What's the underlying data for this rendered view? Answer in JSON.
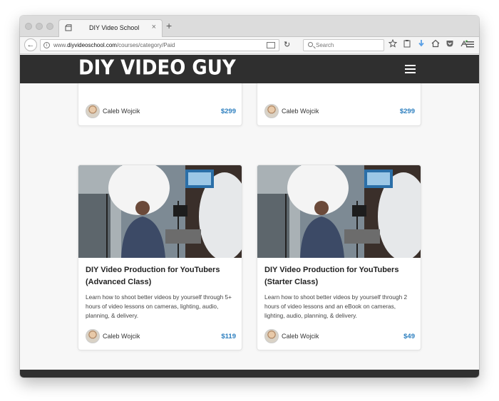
{
  "browser": {
    "tab_title": "DIY Video School",
    "tab_close": "×",
    "new_tab": "+",
    "url_prefix": "www.",
    "url_domain": "diyvideoschool.com",
    "url_path": "/courses/category/Paid",
    "search_placeholder": "Search",
    "back_glyph": "←",
    "reload_glyph": "↻",
    "info_glyph": "i"
  },
  "site": {
    "logo": "DIY VIDEO GUY"
  },
  "courses_top": [
    {
      "author": "Caleb Wojcik",
      "price": "$299"
    },
    {
      "author": "Caleb Wojcik",
      "price": "$299"
    }
  ],
  "courses": [
    {
      "title": "DIY Video Production for YouTubers (Advanced Class)",
      "description": "Learn how to shoot better videos by yourself through 5+ hours of video lessons on cameras, lighting, audio, planning, & delivery.",
      "author": "Caleb Wojcik",
      "price": "$119"
    },
    {
      "title": "DIY Video Production for YouTubers (Starter Class)",
      "description": "Learn how to shoot better videos by yourself through 2 hours of video lessons and an eBook on cameras, lighting, audio, planning, & delivery.",
      "author": "Caleb Wojcik",
      "price": "$49"
    }
  ],
  "icons": {
    "toolbar": [
      "bookmark-star-icon",
      "reading-list-icon",
      "download-icon",
      "home-icon",
      "pocket-icon",
      "extension-icon",
      "hamburger-menu-icon"
    ]
  },
  "colors": {
    "header_bg": "#2f2f2f",
    "price": "#2d7fbf",
    "page_bg": "#f7f7f7"
  }
}
